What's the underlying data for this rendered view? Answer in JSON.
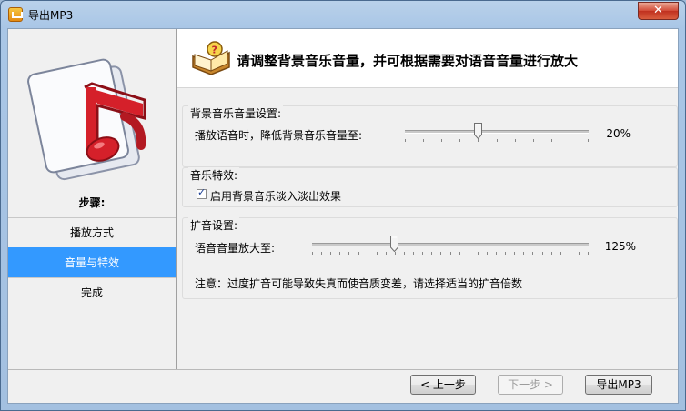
{
  "window": {
    "title": "导出MP3",
    "close_glyph": "✕"
  },
  "sidebar": {
    "logo_icon": "music-note-icon",
    "steps_label": "步骤:",
    "steps": [
      {
        "label": "播放方式",
        "active": false
      },
      {
        "label": "音量与特效",
        "active": true
      },
      {
        "label": "完成",
        "active": false
      }
    ]
  },
  "header": {
    "icon": "book-help-icon",
    "text": "请调整背景音乐音量，并可根据需要对语音音量进行放大"
  },
  "bg_volume": {
    "group_title": "背景音乐音量设置:",
    "label": "播放语音时，降低背景音乐音量至:",
    "value_text": "20%",
    "value_fraction": 0.4
  },
  "effects": {
    "group_title": "音乐特效:",
    "fade_checkbox_label": "启用背景音乐淡入淡出效果",
    "fade_checked": true
  },
  "amplify": {
    "group_title": "扩音设置:",
    "label": "语音音量放大至:",
    "value_text": "125%",
    "value_fraction": 0.3,
    "note": "注意：过度扩音可能导致失真而使音质变差，请选择适当的扩音倍数"
  },
  "buttons": {
    "prev": "< 上一步",
    "next": "下一步 >",
    "export": "导出MP3"
  },
  "colors": {
    "accent": "#3399ff",
    "titlebar": "#a9c6e6",
    "close": "#c0301f"
  }
}
